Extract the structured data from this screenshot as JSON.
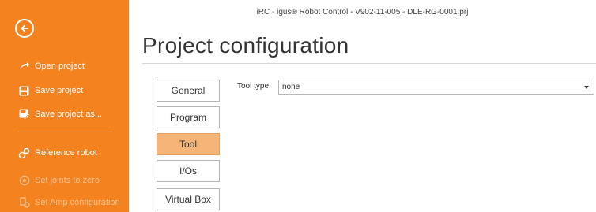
{
  "window": {
    "title": "iRC - igus® Robot Control - V902-11-005 - DLE-RG-0001.prj"
  },
  "sidebar": {
    "background": "#f4821f",
    "back_icon": "back-arrow-circle-icon",
    "items": [
      {
        "label": "Open project",
        "icon": "open-project-icon",
        "enabled": true
      },
      {
        "label": "Save project",
        "icon": "save-icon",
        "enabled": true
      },
      {
        "label": "Save project as...",
        "icon": "save-as-icon",
        "enabled": true
      },
      {
        "label": "Reference robot",
        "icon": "reference-robot-icon",
        "enabled": true
      },
      {
        "label": "Set joints to zero",
        "icon": "set-joints-zero-icon",
        "enabled": false
      },
      {
        "label": "Set Amp configuration",
        "icon": "amp-configuration-icon",
        "enabled": false
      }
    ]
  },
  "main": {
    "page_title": "Project configuration",
    "tabs": [
      {
        "label": "General",
        "active": false
      },
      {
        "label": "Program",
        "active": false
      },
      {
        "label": "Tool",
        "active": true
      },
      {
        "label": "I/Os",
        "active": false
      },
      {
        "label": "Virtual Box",
        "active": false
      }
    ],
    "tool": {
      "label": "Tool type:",
      "value": "none"
    }
  },
  "colors": {
    "accent": "#f4821f",
    "active_tab": "#f5b578"
  }
}
